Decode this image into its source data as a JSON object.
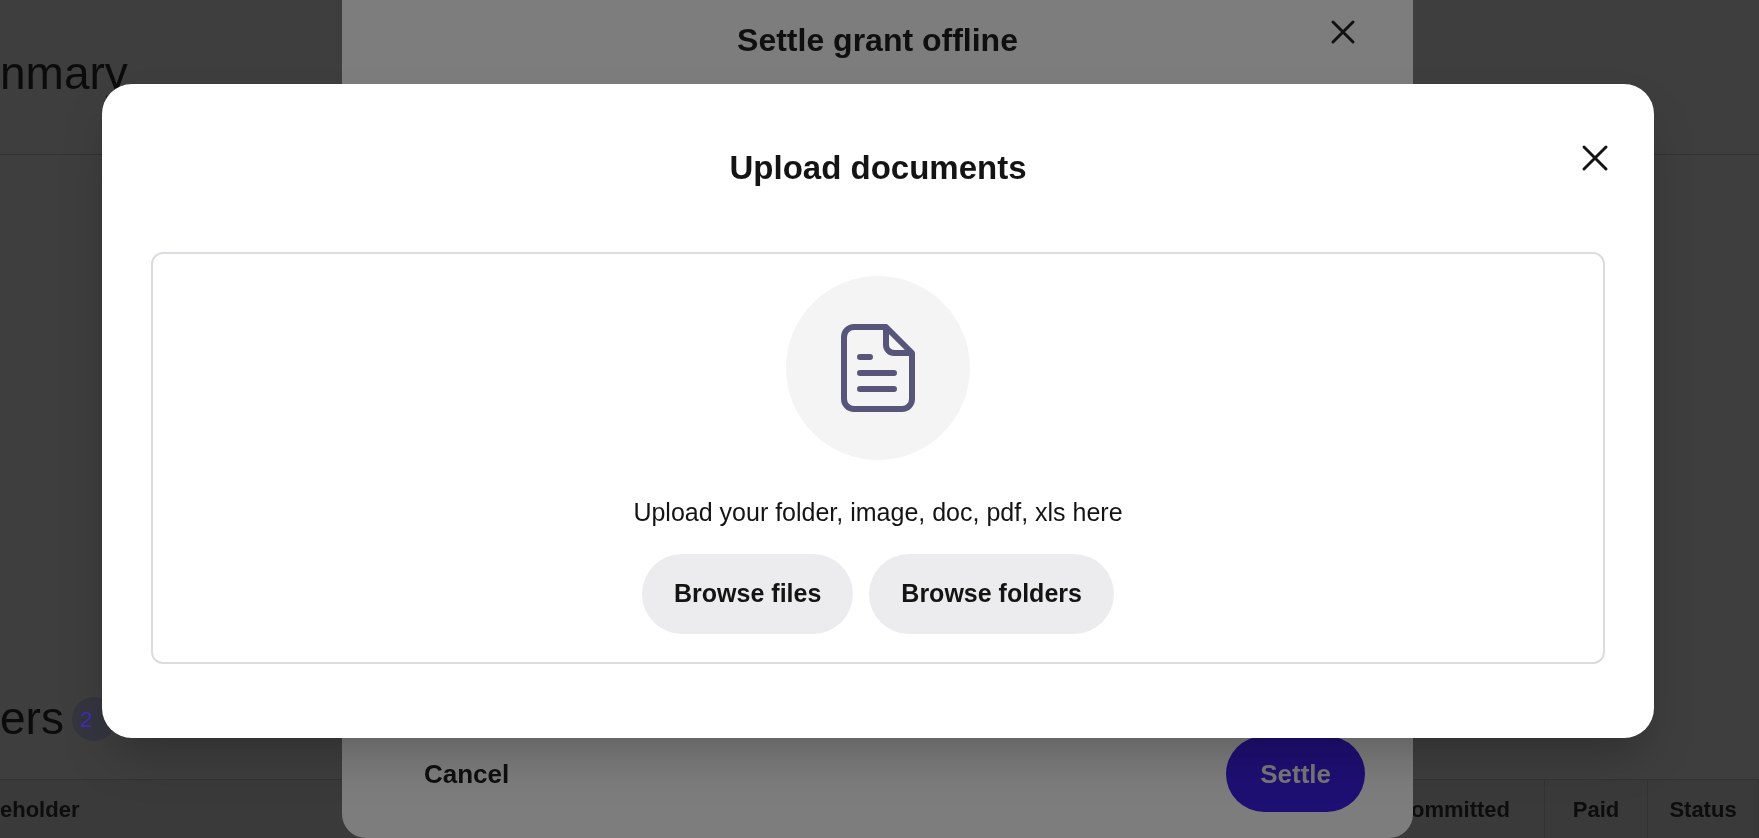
{
  "page": {
    "title": "nmary",
    "section_title": "ers",
    "section_count": "2",
    "table_columns": [
      "eholder",
      "ommitted",
      "Paid",
      "Status"
    ]
  },
  "settle_dialog": {
    "title": "Settle grant offline",
    "cancel": "Cancel",
    "confirm": "Settle"
  },
  "upload_dialog": {
    "title": "Upload documents",
    "hint": "Upload your folder, image, doc, pdf, xls here",
    "buttons": [
      "Browse files",
      "Browse folders"
    ]
  }
}
